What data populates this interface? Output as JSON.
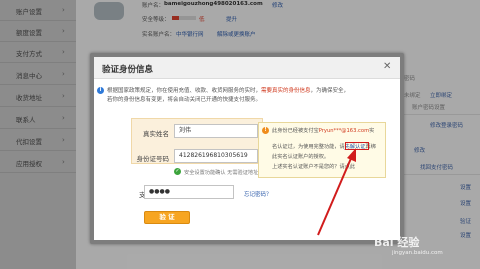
{
  "sidebar": {
    "items": [
      {
        "label": "账户设置",
        "chevron": "›"
      },
      {
        "label": "额度设置",
        "chevron": "›"
      },
      {
        "label": "支付方式",
        "chevron": "›"
      },
      {
        "label": "消息中心",
        "chevron": "›"
      },
      {
        "label": "收货地址",
        "chevron": "›"
      },
      {
        "label": "联系人",
        "chevron": "›"
      },
      {
        "label": "代扣设置",
        "chevron": "›"
      },
      {
        "label": "应用授权",
        "chevron": "›"
      }
    ]
  },
  "background": {
    "account_name_label": "账户名：",
    "account_name": "bameigouzhong498020163.com",
    "account_edit": "修改",
    "security_level_label": "安全等级：",
    "security_level_value": "低",
    "security_level_fraction": 0.3,
    "security_upgrade": "提升",
    "real_name_label": "实名账户名：",
    "real_name_bank": "中华银行网",
    "real_name_link": "解除或更换账户",
    "right_panel": [
      {
        "text": "密码",
        "kind": "gray"
      },
      {
        "text": "未绑定",
        "kind": "gray"
      },
      {
        "text": "立即绑定",
        "kind": "link"
      },
      {
        "text": "账户密码设置",
        "kind": "gray"
      },
      {
        "text": "修改登录密码",
        "kind": "link"
      },
      {
        "text": "修改",
        "kind": "link"
      },
      {
        "text": "找回支付密码",
        "kind": "link"
      },
      {
        "text": "设置",
        "kind": "link"
      },
      {
        "text": "设置",
        "kind": "link"
      },
      {
        "text": "验证",
        "kind": "link"
      },
      {
        "text": "设置",
        "kind": "link"
      }
    ]
  },
  "modal": {
    "title": "验证身份信息",
    "close_glyph": "✕",
    "info_icon_glyph": "i",
    "info_line1_a": "根据国家政策规定，你在使用充值、收款、收货网服务的实时，",
    "info_line1_red": "需要真实的身份信息",
    "info_line1_b": "，为确保安全，",
    "info_line2": "若你的身份信息有变更，将会自动关闭已开通的快捷支付服务。",
    "fields": {
      "real_name_label": "真实姓名",
      "real_name_value": "刘伟",
      "id_number_label": "身份证号码",
      "id_number_value": "412826196810305619",
      "id_hint": "安全设置功能确认 无需验证地址",
      "pay_password_label": "支付密码",
      "pay_password_value": "●●●●"
    },
    "check_glyph": "✓",
    "forgot_password": "忘记密码？",
    "submit_label": "验 证",
    "notice": {
      "icon_glyph": "!",
      "line1_a": "此身份已经被支付宝",
      "line1_red": "Pryun***@163.com",
      "line1_b": "实",
      "line2": "名认证过，为使用完整功能，请",
      "line2_link": "先解认证",
      "line2_b": "再绑",
      "line3": "此实名认证账户的授权。",
      "line4": "上述实名认证账户不是您的？请点此"
    }
  },
  "watermark": {
    "text": "Bai 经验",
    "sub": "jingyan.baidu.com"
  },
  "colors": {
    "accent_orange": "#f7a521",
    "link_blue": "#2a58a8",
    "alert_red": "#d11c1c",
    "sidebar_gray": "#c9c9c9"
  }
}
